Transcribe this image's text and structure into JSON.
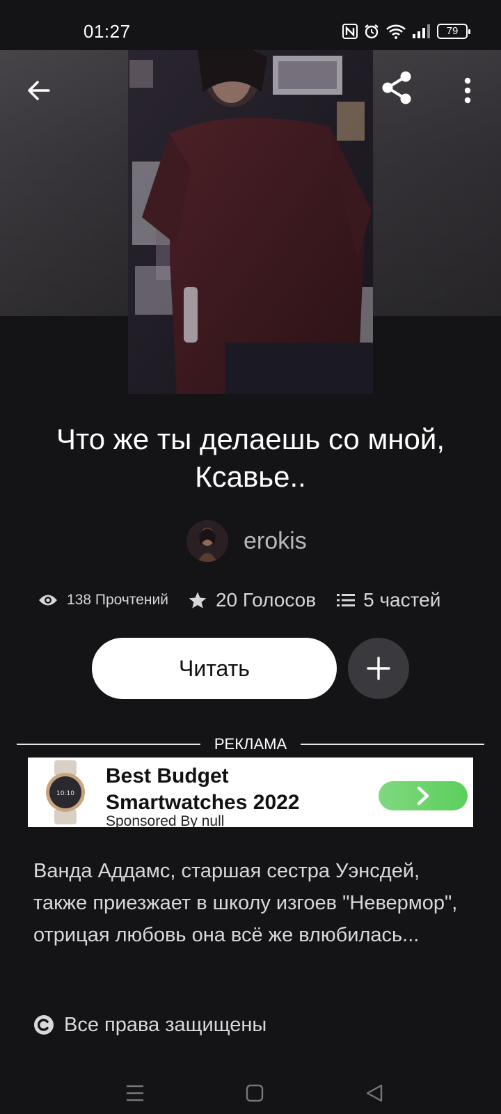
{
  "status_bar": {
    "time": "01:27",
    "battery": "79",
    "icons": [
      "nfc-icon",
      "alarm-icon",
      "wifi-icon",
      "signal-icon",
      "battery-icon"
    ]
  },
  "header": {
    "back_icon": "arrow-left-icon",
    "share_icon": "share-icon",
    "more_icon": "more-vertical-icon"
  },
  "story": {
    "title": "Что же ты делаешь со мной, Ксавье..",
    "author": "erokis",
    "stats": {
      "reads": "138 Прочтений",
      "votes": "20 Голосов",
      "parts": "5 частей"
    },
    "read_label": "Читать",
    "add_icon": "plus-icon",
    "description": "Ванда Аддамс, старшая сестра Уэнсдей, также приезжает в школу изгоев \"Невермор\", отрицая любовь она всё же влюбилась...",
    "copyright": "Все права защищены"
  },
  "ad": {
    "label": "РЕКЛАМА",
    "headline_line1": "Best Budget",
    "headline_line2": "Smartwatches 2022",
    "sponsor": "Sponsored By null",
    "cta_icon": "chevron-right-icon"
  },
  "nav": {
    "menu_icon": "menu-icon",
    "home_icon": "square-home-icon",
    "back_icon": "triangle-back-icon"
  },
  "colors": {
    "background": "#141316",
    "button_primary": "#ffffff",
    "button_secondary": "#3a393d",
    "ad_cta": "#5ccf5c"
  }
}
